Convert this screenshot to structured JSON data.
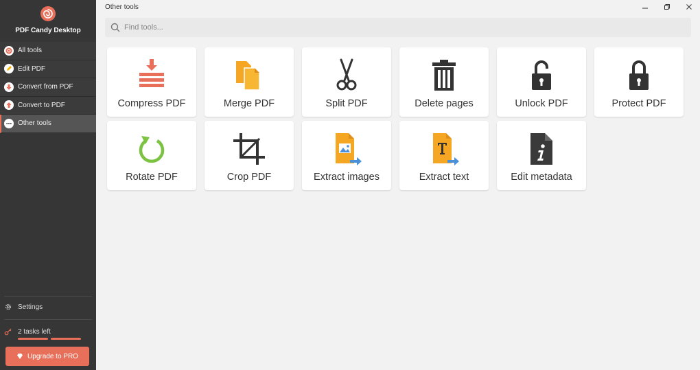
{
  "app": {
    "name": "PDF Candy Desktop",
    "accent_color": "#e8705a"
  },
  "sidebar": {
    "items": [
      {
        "label": "All tools",
        "icon": "candy-icon"
      },
      {
        "label": "Edit PDF",
        "icon": "pencil-icon"
      },
      {
        "label": "Convert from PDF",
        "icon": "arrow-down-icon"
      },
      {
        "label": "Convert to PDF",
        "icon": "arrow-up-icon"
      },
      {
        "label": "Other tools",
        "icon": "more-icon",
        "active": true
      }
    ],
    "settings_label": "Settings",
    "tasks_left": "2 tasks left",
    "upgrade_label": "Upgrade to PRO"
  },
  "header": {
    "title": "Other tools"
  },
  "search": {
    "placeholder": "Find tools..."
  },
  "tools": [
    {
      "label": "Compress PDF",
      "icon": "compress-icon"
    },
    {
      "label": "Merge PDF",
      "icon": "merge-icon"
    },
    {
      "label": "Split PDF",
      "icon": "scissors-icon"
    },
    {
      "label": "Delete pages",
      "icon": "trash-icon"
    },
    {
      "label": "Unlock PDF",
      "icon": "unlock-icon"
    },
    {
      "label": "Protect PDF",
      "icon": "lock-icon"
    },
    {
      "label": "Rotate PDF",
      "icon": "rotate-icon"
    },
    {
      "label": "Crop PDF",
      "icon": "crop-icon"
    },
    {
      "label": "Extract images",
      "icon": "extract-images-icon"
    },
    {
      "label": "Extract text",
      "icon": "extract-text-icon"
    },
    {
      "label": "Edit metadata",
      "icon": "metadata-icon"
    }
  ]
}
